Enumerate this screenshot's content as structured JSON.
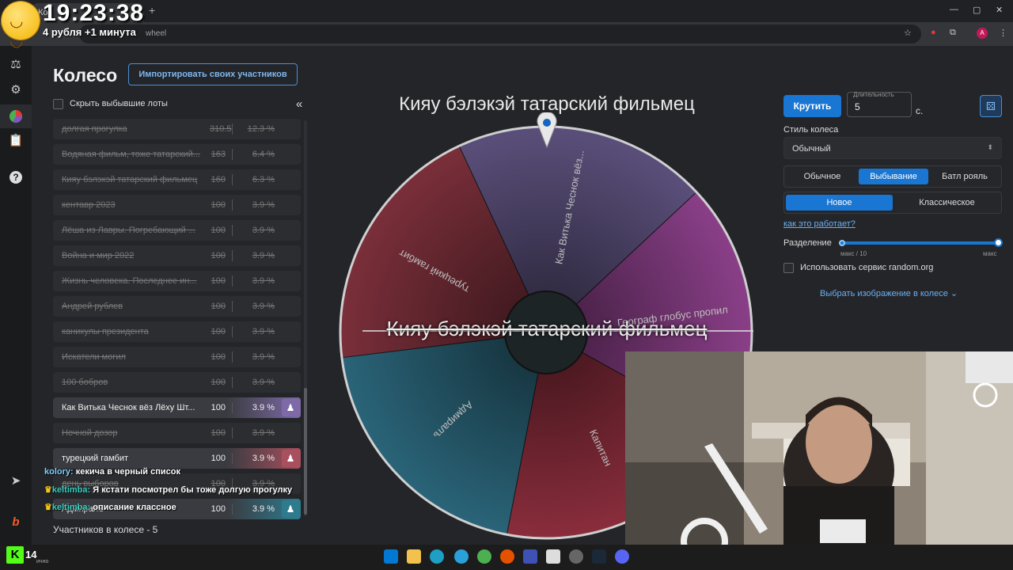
{
  "browser": {
    "tab_title": "Ко",
    "address_fragment": "wheel",
    "profile_initial": "A"
  },
  "overlay": {
    "clock": "19:23:38",
    "rule_text": "4 рубля +1 минута"
  },
  "sidebar": {
    "icons": [
      "gavel-icon",
      "gear-icon",
      "pie-chart-icon",
      "clipboard-icon",
      "help-icon",
      "telegram-icon",
      "boosty-icon"
    ]
  },
  "page": {
    "title": "Колесо",
    "import_button": "Импортировать своих участников",
    "hide_dropped_label": "Скрыть выбывшие лоты",
    "collapse_symbol": "«",
    "participants_count": "Участников в колесе - 5"
  },
  "lots": [
    {
      "name": "долгая прогулка",
      "amount": "310.5",
      "percent": "12.3 %",
      "status": "out"
    },
    {
      "name": "Водяная фильм, тоже татарский...",
      "amount": "163",
      "percent": "6.4 %",
      "status": "out"
    },
    {
      "name": "Кияу бэлэкэй татарский фильмец",
      "amount": "160",
      "percent": "6.3 %",
      "status": "out"
    },
    {
      "name": "кентавр 2023",
      "amount": "100",
      "percent": "3.9 %",
      "status": "out"
    },
    {
      "name": "Лёша из Лавры. Погребающий ...",
      "amount": "100",
      "percent": "3.9 %",
      "status": "out"
    },
    {
      "name": "Война и мир 2022",
      "amount": "100",
      "percent": "3.9 %",
      "status": "out"
    },
    {
      "name": "Жизнь человека. Последнее ин...",
      "amount": "100",
      "percent": "3.9 %",
      "status": "out"
    },
    {
      "name": "Андрей рублев",
      "amount": "100",
      "percent": "3.9 %",
      "status": "out"
    },
    {
      "name": "каникулы президента",
      "amount": "100",
      "percent": "3.9 %",
      "status": "out"
    },
    {
      "name": "Искатели могил",
      "amount": "100",
      "percent": "3.9 %",
      "status": "out"
    },
    {
      "name": "100 бобров",
      "amount": "100",
      "percent": "3.9 %",
      "status": "out"
    },
    {
      "name": "Как Витька Чеснок вёз Лёху Шт...",
      "amount": "100",
      "percent": "3.9 %",
      "status": "active",
      "color": "#7e6aa8"
    },
    {
      "name": "Ночной дозор",
      "amount": "100",
      "percent": "3.9 %",
      "status": "out"
    },
    {
      "name": "турецкий гамбит",
      "amount": "100",
      "percent": "3.9 %",
      "status": "active",
      "color": "#a8505e"
    },
    {
      "name": "день выборов",
      "amount": "100",
      "percent": "3.9 %",
      "status": "out"
    },
    {
      "name": "Адмиралъ",
      "amount": "100",
      "percent": "3.9 %",
      "status": "active",
      "color": "#2e7b8e"
    }
  ],
  "wheel": {
    "title": "Кияу бэлэкэй татарский фильмец",
    "winner_overlay": "Кияу бэлэкэй татарский фильмец",
    "segments": [
      {
        "label": "Как Витька Чеснок вёз...",
        "color": "#5a4f7a"
      },
      {
        "label": "Географ глобус пропил",
        "color": "#8a3f88"
      },
      {
        "label": "Капитан",
        "color": "#8a2d3c"
      },
      {
        "label": "Адмиралъ",
        "color": "#2a6478"
      },
      {
        "label": "турецкий гамбит",
        "color": "#7a2f3a"
      }
    ]
  },
  "controls": {
    "spin_button": "Крутить",
    "duration_label": "Длительность",
    "duration_value": "5",
    "duration_unit": "с.",
    "wheel_style_label": "Стиль колеса",
    "wheel_style_value": "Обычный",
    "mode_tabs": [
      "Обычное",
      "Выбывание",
      "Батл рояль"
    ],
    "mode_selected": "Выбывание",
    "variant_tabs": [
      "Новое",
      "Классическое"
    ],
    "variant_selected": "Новое",
    "how_link": "как это работает?",
    "split_label": "Разделение",
    "split_min": "макс / 10",
    "split_max": "макс",
    "split_level": 1.0,
    "random_org_label": "Использовать сервис random.org",
    "choose_image": "Выбрать изображение в колесе"
  },
  "chat": [
    {
      "user": "kolory:",
      "text": "кекича в черный список"
    },
    {
      "user": "keltimba:",
      "text": "Я кстати посмотрел бы тоже долгую прогулку"
    },
    {
      "user": "keltimba:",
      "text": "описание классное"
    }
  ],
  "stream": {
    "k_badge": "K",
    "viewer_count": "14",
    "status_word": "ично"
  },
  "colors": {
    "accent": "#1976d2",
    "link": "#6ab0f3"
  }
}
